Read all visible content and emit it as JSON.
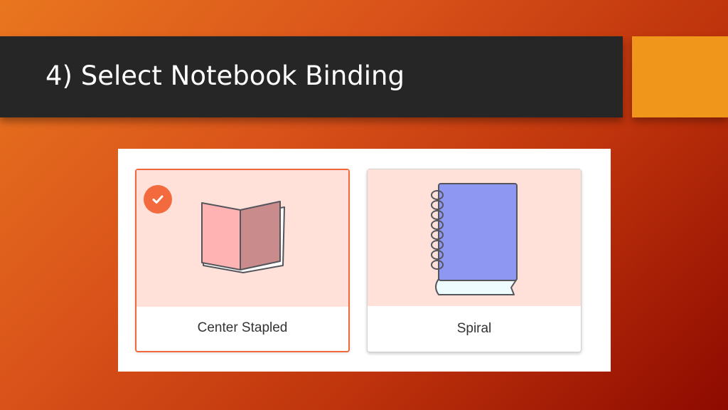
{
  "slide": {
    "title": "4) Select Notebook Binding"
  },
  "colors": {
    "title_bar": "#262626",
    "accent_box": "#f0961a",
    "selected_border": "#f0683c",
    "check_badge": "#f26a3e",
    "card_image_bg": "#ffe1d9",
    "spiral_cover": "#8e98f2"
  },
  "binding_options": [
    {
      "label": "Center Stapled",
      "selected": true,
      "icon": "open-stapled-book-icon"
    },
    {
      "label": "Spiral",
      "selected": false,
      "icon": "spiral-notebook-icon"
    }
  ],
  "selection_icon": "check-icon"
}
